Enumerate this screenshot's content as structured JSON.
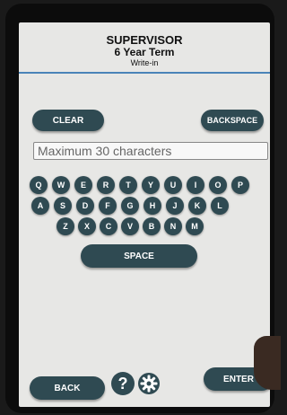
{
  "header": {
    "office": "SUPERVISOR",
    "term": "6 Year Term",
    "subtitle": "Write-in"
  },
  "controls": {
    "clear_label": "CLEAR",
    "backspace_label": "BACKSPACE",
    "space_label": "SPACE",
    "back_label": "BACK",
    "enter_label": "ENTER",
    "help_label": "?"
  },
  "writein_field": {
    "placeholder": "Maximum 30 characters",
    "value": ""
  },
  "keyboard": {
    "row1": [
      "Q",
      "W",
      "E",
      "R",
      "T",
      "Y",
      "U",
      "I",
      "O",
      "P"
    ],
    "row2": [
      "A",
      "S",
      "D",
      "F",
      "G",
      "H",
      "J",
      "K",
      "L"
    ],
    "row3": [
      "Z",
      "X",
      "C",
      "V",
      "B",
      "N",
      "M"
    ]
  },
  "icons": {
    "help": "question-mark-icon",
    "settings": "gear-icon"
  },
  "colors": {
    "button": "#2f4a52",
    "screen_bg": "#e7e7e5",
    "divider": "#4a83b8"
  }
}
